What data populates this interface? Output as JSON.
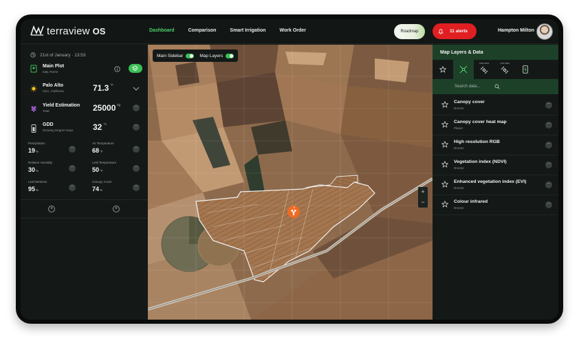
{
  "app": {
    "logo_text": "terraview",
    "logo_suffix": "OS"
  },
  "nav": {
    "items": [
      "Dashboard",
      "Comparison",
      "Smart Irrigation",
      "Work Order"
    ],
    "active": "Dashboard"
  },
  "header": {
    "roadmap_label": "Roadmap",
    "alerts_label": "11 alerts",
    "user_name": "Hampton Milton"
  },
  "left": {
    "date": "21st of January · 13:53",
    "plot": {
      "title": "Main Plot",
      "sub": "Italy, Rome"
    },
    "weather": {
      "title": "Palo Alto",
      "sub": "USA, California",
      "value": "71.3",
      "unit": "°F"
    },
    "yield": {
      "title": "Yield Estimation",
      "sub": "Total",
      "value": "25000",
      "unit": "kg"
    },
    "gdd": {
      "title": "GDD",
      "sub": "Growing Degree Days",
      "value": "32",
      "unit": "°C"
    },
    "metrics": [
      {
        "label": "Precipitation",
        "value": "19",
        "unit": "%"
      },
      {
        "label": "Air Temperature",
        "value": "68",
        "unit": "°F"
      },
      {
        "label": "Relative Humidity",
        "value": "30",
        "unit": "%"
      },
      {
        "label": "Leaf Temperature",
        "value": "50",
        "unit": "°F"
      },
      {
        "label": "Leaf Wetness",
        "value": "95",
        "unit": "%"
      },
      {
        "label": "Canopy Cover",
        "value": "74",
        "unit": "%"
      }
    ]
  },
  "map": {
    "toggles": [
      {
        "label": "Main Sidebar",
        "on": true
      },
      {
        "label": "Map Layers",
        "on": true
      }
    ],
    "zoom_in": "+",
    "zoom_out": "−"
  },
  "right": {
    "title": "Map Layers & Data",
    "tabs": [
      {
        "icon": "star-icon",
        "label": ""
      },
      {
        "icon": "satellite-icon",
        "label": ""
      },
      {
        "icon": "satellite-icon",
        "label": "HIGH RES"
      },
      {
        "icon": "satellite-icon",
        "label": "LOW RES"
      },
      {
        "icon": "phone-icon",
        "label": ""
      }
    ],
    "search_placeholder": "Search data...",
    "layers": [
      {
        "title": "Canopy cover",
        "sub": "Drones"
      },
      {
        "title": "Canopy cover heat map",
        "sub": "Planet"
      },
      {
        "title": "High resolution RGB",
        "sub": "Drones"
      },
      {
        "title": "Vegetation index (NDVI)",
        "sub": "Drones"
      },
      {
        "title": "Enhanced vegetation index (EVI)",
        "sub": "Drones"
      },
      {
        "title": "Colour infrared",
        "sub": "Drones"
      }
    ]
  },
  "colors": {
    "accent": "#4fd06a",
    "alert": "#e01f22",
    "panel": "#141917",
    "header_green": "#1d4029"
  }
}
